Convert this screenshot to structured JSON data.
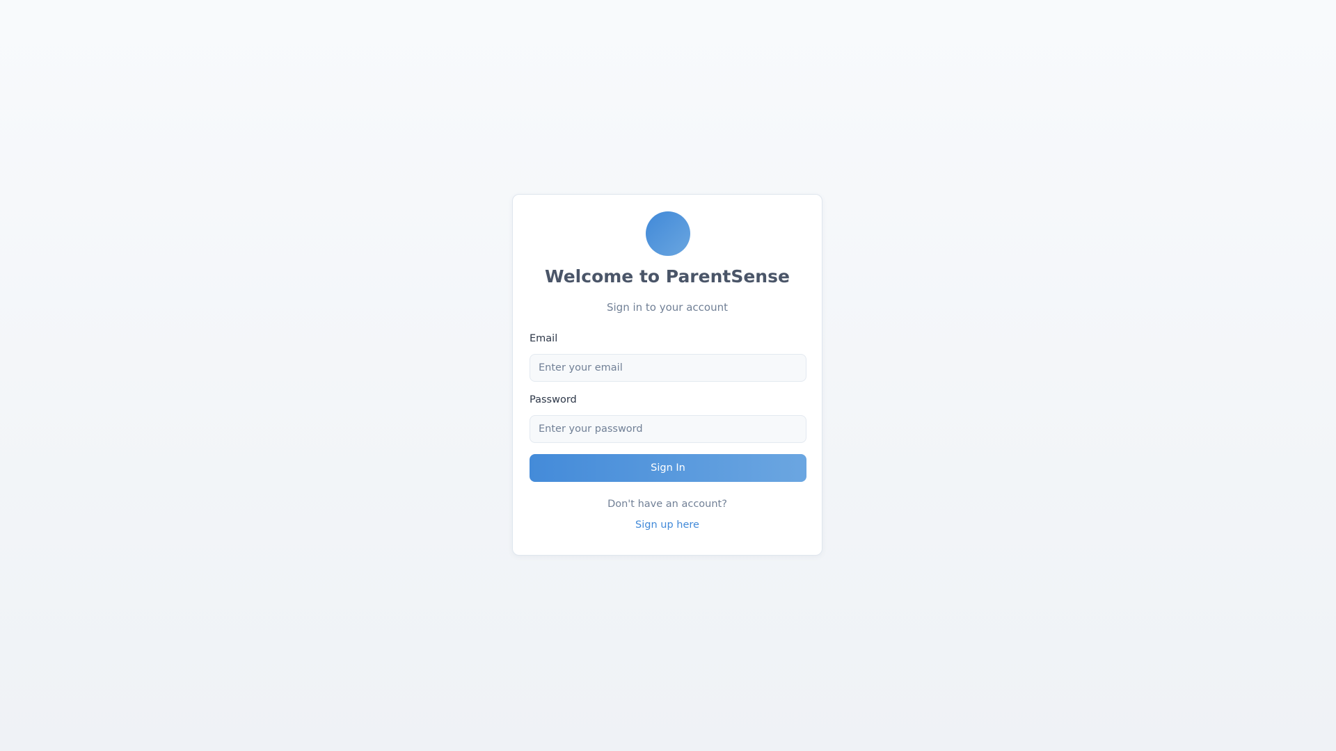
{
  "colors": {
    "accent": "#4189d8",
    "button_gradient_start": "#448bd9",
    "button_gradient_end": "#6ba6e1",
    "title": "#4a5568",
    "muted": "#718096"
  },
  "login": {
    "logo_icon": "circle-logo",
    "title": "Welcome to ParentSense",
    "subtitle": "Sign in to your account",
    "email": {
      "label": "Email",
      "value": "",
      "placeholder": "Enter your email"
    },
    "password": {
      "label": "Password",
      "value": "",
      "placeholder": "Enter your password"
    },
    "submit_label": "Sign In",
    "footer_text": "Don't have an account?",
    "signup_link_label": "Sign up here"
  }
}
